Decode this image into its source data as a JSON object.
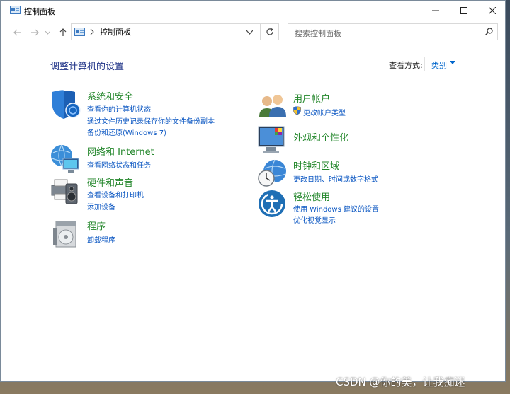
{
  "window": {
    "title": "控制面板"
  },
  "titlebar": {
    "minimize": "—",
    "maximize": "☐",
    "close": "✕"
  },
  "address": {
    "path": "控制面板"
  },
  "search": {
    "placeholder": "搜索控制面板"
  },
  "main": {
    "title": "调整计算机的设置",
    "view_by_label": "查看方式:",
    "view_by_value": "类别"
  },
  "categories": {
    "system_security": {
      "title": "系统和安全",
      "links": [
        "查看你的计算机状态",
        "通过文件历史记录保存你的文件备份副本",
        "备份和还原(Windows 7)"
      ]
    },
    "network": {
      "title": "网络和 Internet",
      "links": [
        "查看网络状态和任务"
      ]
    },
    "hardware": {
      "title": "硬件和声音",
      "links": [
        "查看设备和打印机",
        "添加设备"
      ]
    },
    "programs": {
      "title": "程序",
      "links": [
        "卸载程序"
      ]
    },
    "user_accounts": {
      "title": "用户帐户",
      "links": [
        "更改帐户类型"
      ]
    },
    "appearance": {
      "title": "外观和个性化",
      "links": []
    },
    "clock_region": {
      "title": "时钟和区域",
      "links": [
        "更改日期、时间或数字格式"
      ]
    },
    "ease_access": {
      "title": "轻松使用",
      "links": [
        "使用 Windows 建议的设置",
        "优化视觉显示"
      ]
    }
  },
  "watermark": "CSDN @你的美，让我痴迷",
  "colors": {
    "link": "#0a56c2",
    "category": "#22862a",
    "title": "#1e3287"
  }
}
